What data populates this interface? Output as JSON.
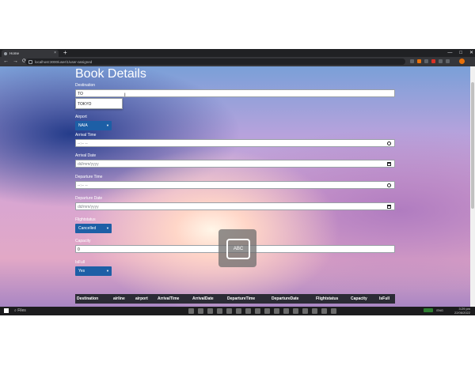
{
  "browser": {
    "tab_title": "Home",
    "tab_close": "×",
    "new_tab": "+",
    "url": "localhost:3000/user/1/user-assigned",
    "nav": {
      "back": "←",
      "forward": "→",
      "reload": "⟳"
    },
    "window_controls": {
      "minimize": "—",
      "maximize": "□",
      "close": "✕"
    }
  },
  "page": {
    "title": "Book Details",
    "destination": {
      "label": "Destination",
      "value": "TO"
    },
    "autocomplete": {
      "option": "TOKYO"
    },
    "airport": {
      "label": "Airport",
      "value": "NAIA"
    },
    "arrival_time": {
      "label": "Arrival Time",
      "placeholder": "--:-- --"
    },
    "arrival_date": {
      "label": "Arrival Date",
      "placeholder": "dd/mm/yyyy"
    },
    "departure_time": {
      "label": "Departure Time",
      "placeholder": "--:-- --"
    },
    "departure_date": {
      "label": "Departure Date",
      "placeholder": "dd/mm/yyyy"
    },
    "flightstatus": {
      "label": "Flightstatus",
      "value": "Cancelled"
    },
    "capacity": {
      "label": "Capacity",
      "value": "0"
    },
    "isfull": {
      "label": "IsFull",
      "value": "Yes"
    },
    "table_headers": [
      "Destination",
      "airline",
      "airport",
      "ArrivalTime",
      "ArrivalDate",
      "DepartureTime",
      "DepartureDate",
      "Flightstatus",
      "Capacity",
      "IsFull"
    ]
  },
  "overlay": {
    "label": "ABC"
  },
  "taskbar": {
    "search": "Files",
    "tray_label": "ENG",
    "time": "3:29 pm",
    "date": "22/06/2022"
  },
  "icons": [
    "search-icon",
    "clock-icon",
    "calendar-icon",
    "keyboard-icon",
    "windows-start-icon"
  ]
}
